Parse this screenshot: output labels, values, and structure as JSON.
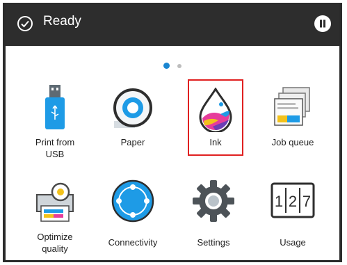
{
  "status_bar": {
    "status_text": "Ready",
    "status_icon": "check-circle-icon",
    "pause_icon": "pause-icon",
    "background_color": "#2d2d2d"
  },
  "pagination": {
    "total_pages": 2,
    "current_page": 1,
    "active_color": "#1a86d1"
  },
  "apps": [
    {
      "id": "print-from-usb",
      "label_line1": "Print from",
      "label_line2": "USB",
      "icon": "usb-drive-icon"
    },
    {
      "id": "paper",
      "label_line1": "Paper",
      "label_line2": "",
      "icon": "paper-roll-icon"
    },
    {
      "id": "ink",
      "label_line1": "Ink",
      "label_line2": "",
      "icon": "ink-drop-icon",
      "selected": true
    },
    {
      "id": "job-queue",
      "label_line1": "Job queue",
      "label_line2": "",
      "icon": "job-queue-icon"
    },
    {
      "id": "optimize-quality",
      "label_line1": "Optimize",
      "label_line2": "quality",
      "icon": "optimize-quality-icon"
    },
    {
      "id": "connectivity",
      "label_line1": "Connectivity",
      "label_line2": "",
      "icon": "connectivity-icon"
    },
    {
      "id": "settings",
      "label_line1": "Settings",
      "label_line2": "",
      "icon": "gear-icon"
    },
    {
      "id": "usage",
      "label_line1": "Usage",
      "label_line2": "",
      "icon": "usage-counter-icon"
    }
  ],
  "usage_counter_digits": [
    "1",
    "2",
    "7"
  ],
  "selection_color": "#e02020"
}
